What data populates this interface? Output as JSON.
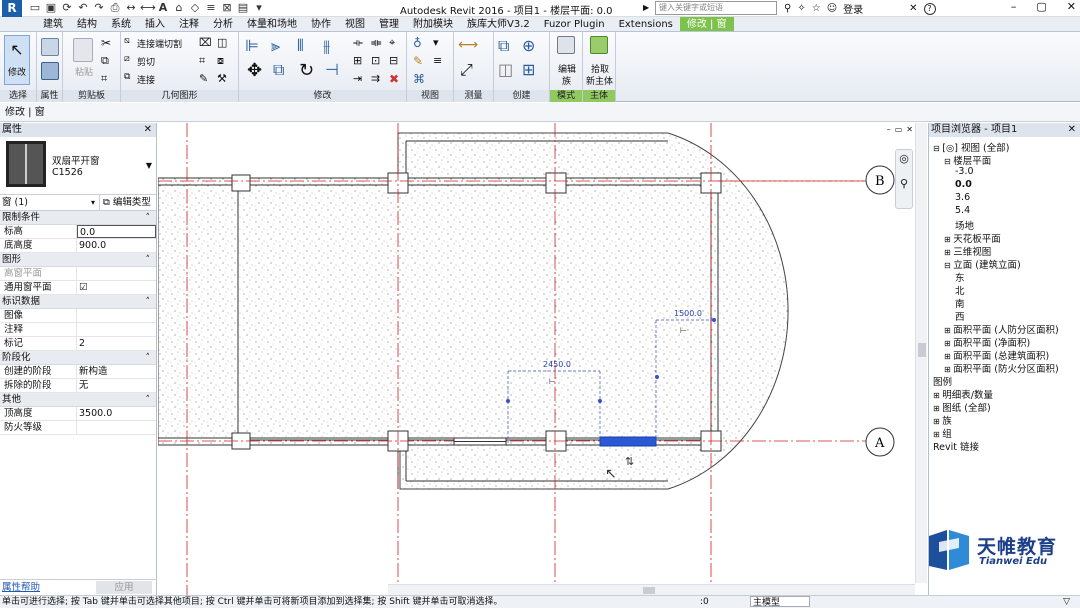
{
  "titlebar": {
    "app_button": "R",
    "title": "Autodesk Revit 2016 -    项目1 - 楼层平面: 0.0",
    "search_placeholder": "键入关键字或短语",
    "login": "登录",
    "help": "?"
  },
  "ribbon_tabs": [
    "建筑",
    "结构",
    "系统",
    "插入",
    "注释",
    "分析",
    "体量和场地",
    "协作",
    "视图",
    "管理",
    "附加模块",
    "族库大师V3.2",
    "Fuzor Plugin",
    "Extensions",
    "修改 | 窗"
  ],
  "active_tab_index": 14,
  "ribbon": {
    "select": {
      "modify_label": "修改",
      "panel": "选择"
    },
    "properties_panel": "属性",
    "clipboard": {
      "paste_label": "粘贴",
      "panel": "剪贴板"
    },
    "geometry": {
      "items": [
        "连接端切割",
        "剪切",
        "连接"
      ],
      "panel": "几何图形"
    },
    "modify_panel": "修改",
    "view_panel": "视图",
    "measure_panel": "测量",
    "create_panel": "创建",
    "mode": {
      "label1": "编辑",
      "label2": "族",
      "panel": "模式"
    },
    "host": {
      "label1": "拾取",
      "label2": "新主体",
      "panel": "主体"
    }
  },
  "context_bar": "修改 | 窗",
  "properties": {
    "header": "属性",
    "type_name": "双扇平开窗",
    "type_sub": "C1526",
    "selector": "窗 (1)",
    "edit_type": "编辑类型",
    "groups": [
      {
        "name": "限制条件",
        "rows": [
          {
            "k": "标高",
            "v": "0.0"
          },
          {
            "k": "底高度",
            "v": "900.0"
          }
        ]
      },
      {
        "name": "图形",
        "rows": [
          {
            "k": "高窗平面",
            "v": ""
          },
          {
            "k": "通用窗平面",
            "v": "☑"
          }
        ]
      },
      {
        "name": "标识数据",
        "rows": [
          {
            "k": "图像",
            "v": ""
          },
          {
            "k": "注释",
            "v": ""
          },
          {
            "k": "标记",
            "v": "2"
          }
        ]
      },
      {
        "name": "阶段化",
        "rows": [
          {
            "k": "创建的阶段",
            "v": "新构造"
          },
          {
            "k": "拆除的阶段",
            "v": "无"
          }
        ]
      },
      {
        "name": "其他",
        "rows": [
          {
            "k": "顶高度",
            "v": "3500.0"
          },
          {
            "k": "防火等级",
            "v": ""
          }
        ]
      }
    ],
    "help_link": "属性帮助",
    "apply": "应用"
  },
  "canvas": {
    "grid_b": "B",
    "grid_a": "A",
    "dim_1500": "1500.0",
    "dim_2450": "2450.0"
  },
  "browser": {
    "header": "项目浏览器 - 项目1",
    "nodes": [
      {
        "t": "[◎] 视图 (全部)",
        "lvl": 0,
        "exp": "⊟"
      },
      {
        "t": "楼层平面",
        "lvl": 1,
        "exp": "⊟"
      },
      {
        "t": "-3.0",
        "lvl": 2,
        "exp": ""
      },
      {
        "t": "0.0",
        "lvl": 2,
        "exp": "",
        "bold": true
      },
      {
        "t": "3.6",
        "lvl": 2,
        "exp": ""
      },
      {
        "t": "5.4",
        "lvl": 2,
        "exp": ""
      },
      {
        "t": "场地",
        "lvl": 2,
        "exp": ""
      },
      {
        "t": "天花板平面",
        "lvl": 1,
        "exp": "⊞"
      },
      {
        "t": "三维视图",
        "lvl": 1,
        "exp": "⊞"
      },
      {
        "t": "立面 (建筑立面)",
        "lvl": 1,
        "exp": "⊟"
      },
      {
        "t": "东",
        "lvl": 2,
        "exp": ""
      },
      {
        "t": "北",
        "lvl": 2,
        "exp": ""
      },
      {
        "t": "南",
        "lvl": 2,
        "exp": ""
      },
      {
        "t": "西",
        "lvl": 2,
        "exp": ""
      },
      {
        "t": "面积平面 (人防分区面积)",
        "lvl": 1,
        "exp": "⊞"
      },
      {
        "t": "面积平面 (净面积)",
        "lvl": 1,
        "exp": "⊞"
      },
      {
        "t": "面积平面 (总建筑面积)",
        "lvl": 1,
        "exp": "⊞"
      },
      {
        "t": "面积平面 (防火分区面积)",
        "lvl": 1,
        "exp": "⊞"
      },
      {
        "t": "图例",
        "lvl": 0,
        "exp": ""
      },
      {
        "t": "明细表/数量",
        "lvl": 0,
        "exp": "⊞"
      },
      {
        "t": "图纸 (全部)",
        "lvl": 0,
        "exp": "⊞"
      },
      {
        "t": "族",
        "lvl": 0,
        "exp": "⊞"
      },
      {
        "t": "组",
        "lvl": 0,
        "exp": "⊞"
      },
      {
        "t": "Revit 链接",
        "lvl": 0,
        "exp": ""
      }
    ]
  },
  "watermark": {
    "cn": "天帷教育",
    "en": "Tianwei Edu"
  },
  "status": {
    "hint": "单击可进行选择; 按 Tab 键并单击可选择其他项目; 按 Ctrl 键并单击可将新项目添加到选择集; 按 Shift 键并单击可取消选择。",
    "coord": ":0",
    "model": "主模型"
  },
  "colors": {
    "accent": "#7cc24c",
    "selected_window": "#2b59d6",
    "dim": "#3a4fc4"
  }
}
